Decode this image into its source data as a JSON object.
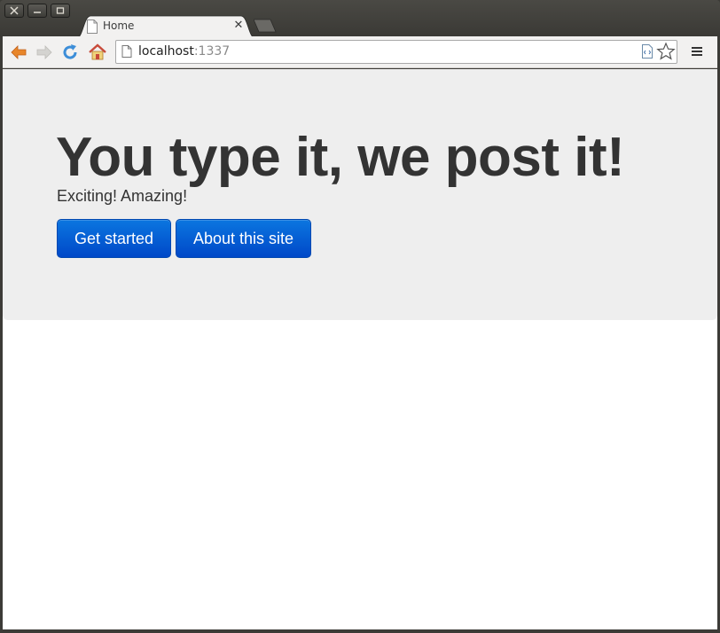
{
  "window": {
    "controls": {
      "close": "close",
      "minimize": "minimize",
      "maximize": "maximize"
    }
  },
  "tabs": [
    {
      "title": "Home",
      "active": true,
      "icon": "page-icon"
    }
  ],
  "toolbar": {
    "url_host": "localhost",
    "url_port": ":1337",
    "icons": [
      "back-icon",
      "forward-icon",
      "reload-icon",
      "home-icon",
      "page-icon",
      "page-action-icon",
      "star-icon",
      "menu-icon"
    ]
  },
  "page": {
    "headline": "You type it, we post it!",
    "tagline": "Exciting! Amazing!",
    "buttons": {
      "get_started": "Get started",
      "about": "About this site"
    }
  },
  "colors": {
    "button_blue": "#0060d8",
    "jumbotron_bg": "#eeeeee",
    "text": "#333333"
  }
}
